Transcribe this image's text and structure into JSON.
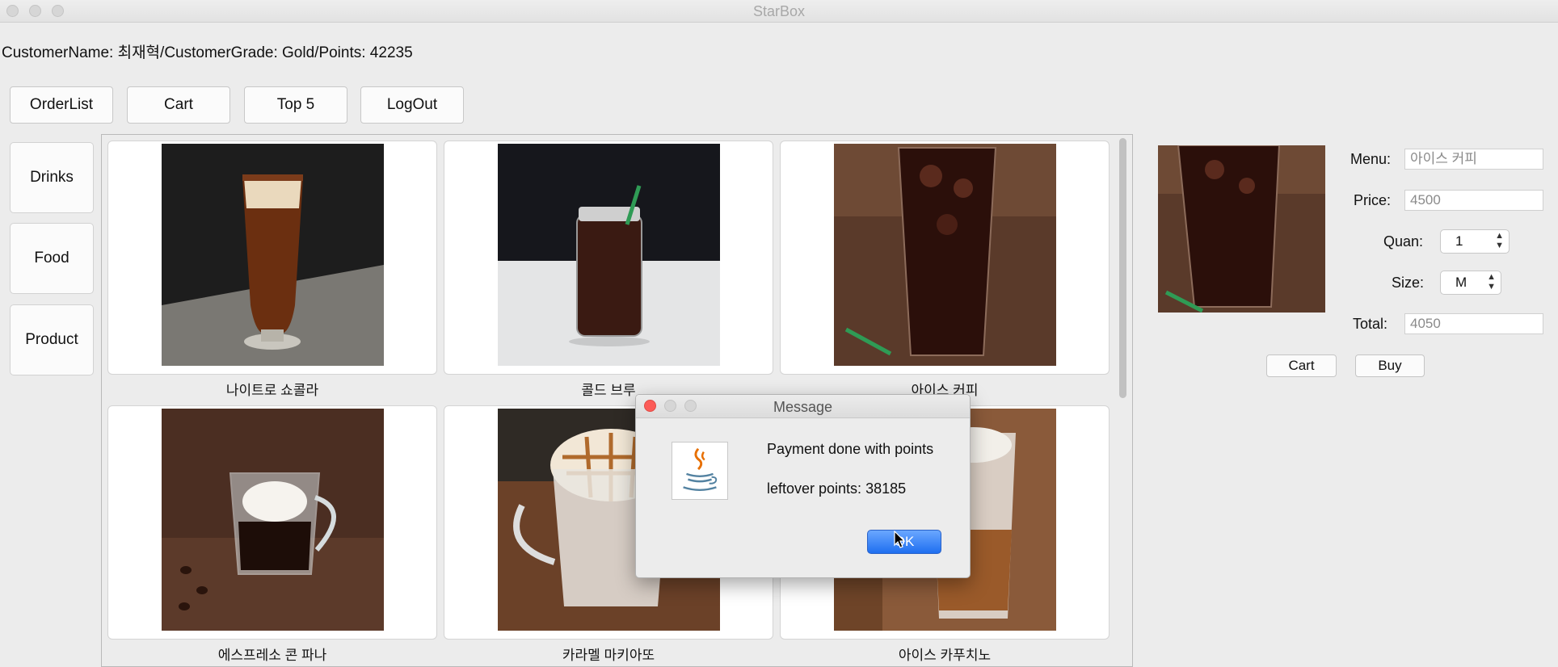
{
  "window": {
    "title": "StarBox"
  },
  "customer_info": "CustomerName: 최재혁/CustomerGrade: Gold/Points: 42235",
  "top_buttons": [
    "OrderList",
    "Cart",
    "Top 5",
    "LogOut"
  ],
  "categories": [
    "Drinks",
    "Food",
    "Product"
  ],
  "menu_items": [
    {
      "name": "나이트로 쇼콜라"
    },
    {
      "name": "콜드 브루"
    },
    {
      "name": "아이스 커피"
    },
    {
      "name": "에스프레소 콘 파나"
    },
    {
      "name": "카라멜 마키아또"
    },
    {
      "name": "아이스 카푸치노"
    }
  ],
  "detail": {
    "menu_label": "Menu:",
    "menu_value": "아이스 커피",
    "price_label": "Price:",
    "price_value": "4500",
    "quan_label": "Quan:",
    "quan_value": "1",
    "size_label": "Size:",
    "size_value": "M",
    "total_label": "Total:",
    "total_value": "4050",
    "cart_button": "Cart",
    "buy_button": "Buy"
  },
  "dialog": {
    "title": "Message",
    "line1": "Payment done with points",
    "line2": "leftover points: 38185",
    "ok_button": "OK"
  },
  "colors": {
    "window_bg": "#ececec",
    "ok_button": "#1f6ff0",
    "close_dot": "#fc5b57"
  },
  "icons": [
    "java-coffee-cup-icon",
    "mouse-pointer-icon"
  ]
}
